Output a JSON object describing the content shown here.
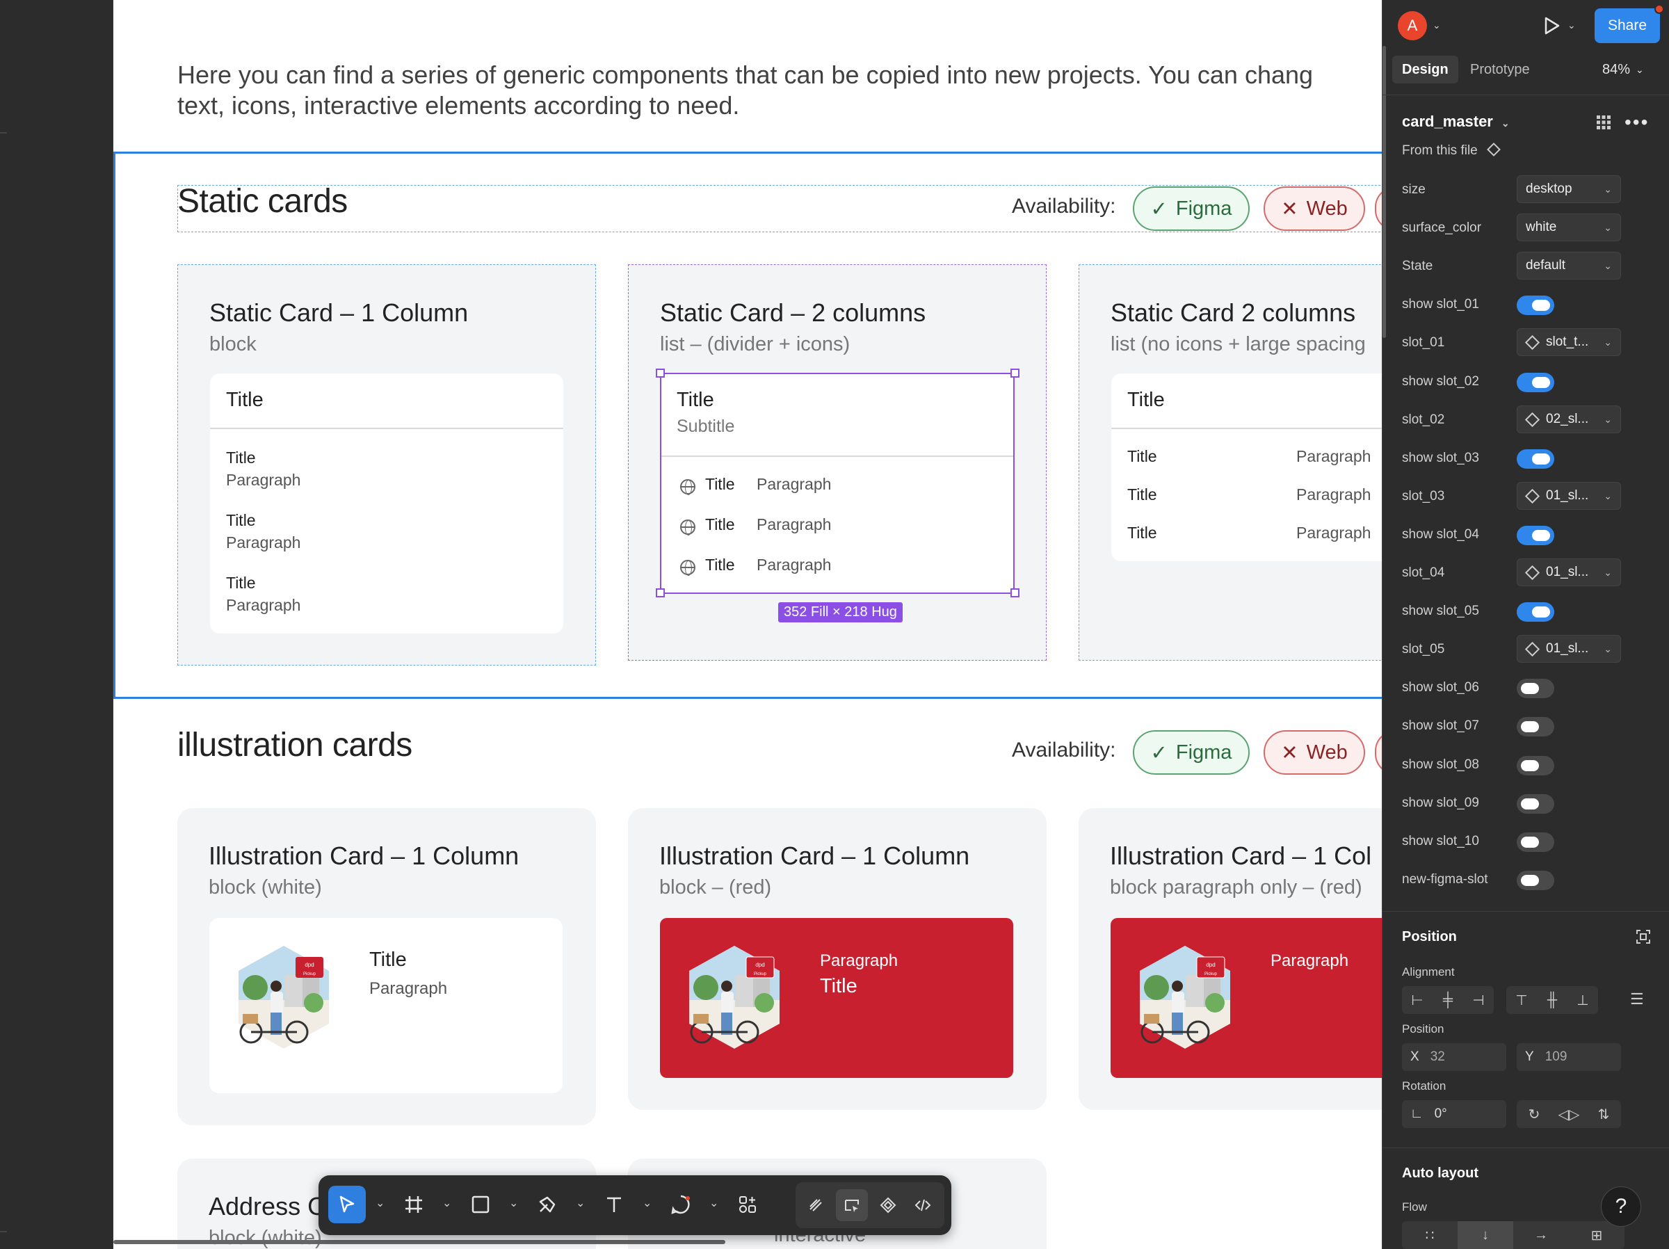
{
  "canvas": {
    "intro_line1": "Here you can find a series of generic components that can be copied into new projects. You can chang",
    "intro_line2": "text, icons, interactive elements according to need.",
    "static_section": {
      "title": "Static cards",
      "availability_label": "Availability:",
      "chip_figma": "Figma",
      "chip_web": "Web",
      "panels": [
        {
          "title": "Static Card – 1 Column",
          "subtitle": "block",
          "card_title": "Title",
          "items": [
            {
              "title": "Title",
              "paragraph": "Paragraph"
            },
            {
              "title": "Title",
              "paragraph": "Paragraph"
            },
            {
              "title": "Title",
              "paragraph": "Paragraph"
            }
          ]
        },
        {
          "title": "Static Card – 2 columns",
          "subtitle": "list – (divider + icons)",
          "card_title": "Title",
          "card_subtitle": "Subtitle",
          "items": [
            {
              "title": "Title",
              "paragraph": "Paragraph"
            },
            {
              "title": "Title",
              "paragraph": "Paragraph"
            },
            {
              "title": "Title",
              "paragraph": "Paragraph"
            }
          ],
          "selection_size": "352 Fill × 218 Hug"
        },
        {
          "title": "Static Card 2 columns",
          "subtitle": "list (no icons + large spacing",
          "card_title": "Title",
          "items": [
            {
              "title": "Title",
              "paragraph": "Paragraph"
            },
            {
              "title": "Title",
              "paragraph": "Paragraph"
            },
            {
              "title": "Title",
              "paragraph": "Paragraph"
            }
          ]
        }
      ]
    },
    "illustration_section": {
      "title": "illustration cards",
      "availability_label": "Availability:",
      "chip_figma": "Figma",
      "chip_web": "Web",
      "panels": [
        {
          "title": "Illustration Card – 1 Column",
          "subtitle": "block (white)",
          "card_title": "Title",
          "card_paragraph": "Paragraph"
        },
        {
          "title": "Illustration Card – 1 Column",
          "subtitle": "block – (red)",
          "card_paragraph": "Paragraph",
          "card_title": "Title"
        },
        {
          "title": "Illustration Card – 1 Col",
          "subtitle": "block paragraph only – (red)",
          "card_paragraph": "Paragraph"
        }
      ],
      "sign_dpd": "dpd",
      "sign_pickup": "Pickup"
    },
    "bottom_section": {
      "panel1_title": "Address C",
      "panel1_subtitle": "block (white)",
      "panel2_subtitle": "interactive"
    }
  },
  "toolbar": {
    "tools": [
      "move-tool",
      "frame-tool",
      "rectangle-tool",
      "pen-tool",
      "text-tool",
      "comment-tool",
      "actions-tool"
    ],
    "modes": [
      "draw-mode",
      "design-mode",
      "component-mode",
      "dev-mode"
    ]
  },
  "right_panel": {
    "avatar_initial": "A",
    "share_label": "Share",
    "tab_design": "Design",
    "tab_prototype": "Prototype",
    "zoom": "84%",
    "component_name": "card_master",
    "from_file": "From this file",
    "properties": [
      {
        "label": "size",
        "type": "dropdown",
        "value": "desktop"
      },
      {
        "label": "surface_color",
        "type": "dropdown",
        "value": "white"
      },
      {
        "label": "State",
        "type": "dropdown",
        "value": "default"
      },
      {
        "label": "show slot_01",
        "type": "toggle",
        "on": true
      },
      {
        "label": "slot_01",
        "type": "instance",
        "value": "slot_t..."
      },
      {
        "label": "show slot_02",
        "type": "toggle",
        "on": true
      },
      {
        "label": "slot_02",
        "type": "instance",
        "value": "02_sl..."
      },
      {
        "label": "show slot_03",
        "type": "toggle",
        "on": true
      },
      {
        "label": "slot_03",
        "type": "instance",
        "value": "01_sl..."
      },
      {
        "label": "show slot_04",
        "type": "toggle",
        "on": true
      },
      {
        "label": "slot_04",
        "type": "instance",
        "value": "01_sl..."
      },
      {
        "label": "show slot_05",
        "type": "toggle",
        "on": true
      },
      {
        "label": "slot_05",
        "type": "instance",
        "value": "01_sl..."
      },
      {
        "label": "show slot_06",
        "type": "toggle",
        "on": false
      },
      {
        "label": "show slot_07",
        "type": "toggle",
        "on": false
      },
      {
        "label": "show slot_08",
        "type": "toggle",
        "on": false
      },
      {
        "label": "show slot_09",
        "type": "toggle",
        "on": false
      },
      {
        "label": "show slot_10",
        "type": "toggle",
        "on": false
      },
      {
        "label": "new-figma-slot",
        "type": "toggle",
        "on": false
      }
    ],
    "position_heading": "Position",
    "alignment_label": "Alignment",
    "position_label": "Position",
    "x_label": "X",
    "x_value": "32",
    "y_label": "Y",
    "y_value": "109",
    "rotation_label": "Rotation",
    "rotation_value": "0°",
    "auto_layout_heading": "Auto layout",
    "flow_label": "Flow",
    "help": "?"
  },
  "colors": {
    "accent_blue": "#2f86eb",
    "selection_purple": "#8b4fe6",
    "dpd_red": "#c8202f",
    "figma_chip_green": "#5aa46f",
    "web_chip_red": "#d46a6a"
  }
}
